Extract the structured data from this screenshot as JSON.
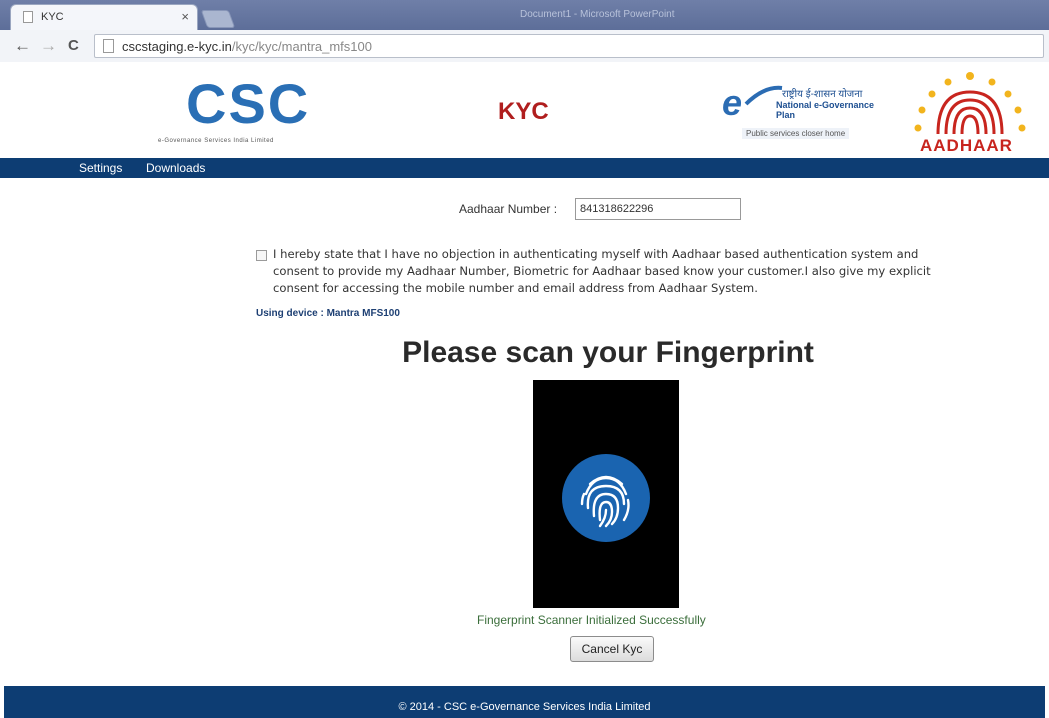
{
  "browser": {
    "tab_title": "KYC",
    "tab_close": "×",
    "window_title": "Document1 - Microsoft PowerPoint",
    "url_host": "cscstaging.e-kyc.in",
    "url_path": "/kyc/kyc/mantra_mfs100",
    "back": "←",
    "forward": "→",
    "reload": "C"
  },
  "header": {
    "csc_letters": "CSC",
    "csc_tagline": "e-Governance Services India Limited",
    "kyc_title": "KYC",
    "negp_letter": "e",
    "negp_hindi": "राष्ट्रीय ई-शासन योजना",
    "negp_english": "National e-Governance Plan",
    "negp_tagline": "Public services closer home",
    "aadhaar_word": "AADHAAR"
  },
  "nav": {
    "items": [
      "Settings",
      "Downloads"
    ]
  },
  "form": {
    "aadhaar_label": "Aadhaar Number :",
    "aadhaar_value": "841318622296",
    "consent_text": "I hereby state that I have no objection in authenticating myself with Aadhaar based authentication system and consent to provide my Aadhaar Number, Biometric for Aadhaar based know your customer.I also give my explicit consent for accessing the mobile number and email address from Aadhaar System.",
    "consent_checked": false,
    "device_line": "Using device : Mantra MFS100",
    "scan_title": "Please scan your Fingerprint",
    "status_text": "Fingerprint Scanner Initialized Successfully",
    "cancel_label": "Cancel Kyc"
  },
  "footer": {
    "text": "© 2014 - CSC e-Governance Services India Limited"
  },
  "colors": {
    "nav_bg": "#0d3d73",
    "csc_blue": "#2a6fb5",
    "kyc_red": "#b01e1e",
    "status_green": "#3b6e3b",
    "fingerprint_blue": "#1a64b0"
  }
}
